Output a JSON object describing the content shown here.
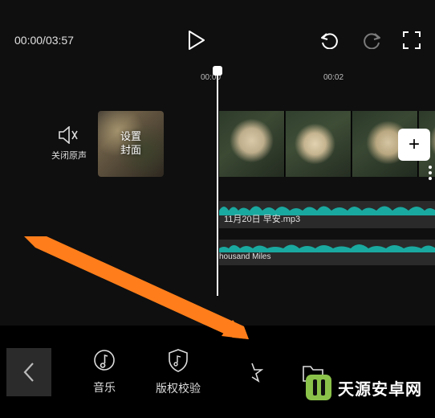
{
  "topbar": {
    "current_time": "00:00",
    "total_time": "03:57",
    "separator": "/"
  },
  "ruler": {
    "t0": "00:00",
    "t1": "00:02"
  },
  "mute": {
    "label": "关闭原声"
  },
  "cover": {
    "line1": "设置",
    "line2": "封面"
  },
  "add_btn": {
    "glyph": "+"
  },
  "audio1": {
    "label": "11月20日 早安.mp3"
  },
  "audio2": {
    "label": "housand Miles"
  },
  "bottom": {
    "music": "音乐",
    "rights": "版权校验"
  },
  "watermark": {
    "text": "天源安卓网"
  }
}
